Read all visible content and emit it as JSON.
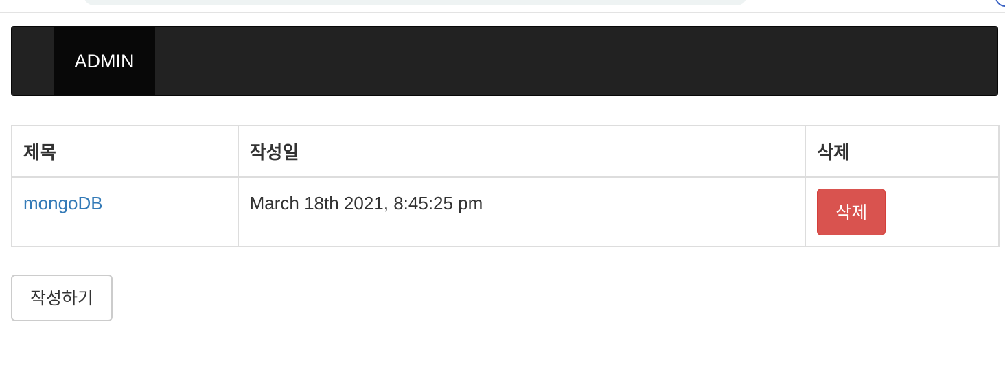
{
  "navbar": {
    "brand": "ADMIN"
  },
  "table": {
    "headers": {
      "title": "제목",
      "date": "작성일",
      "delete": "삭제"
    },
    "rows": [
      {
        "title": "mongoDB",
        "date": "March 18th 2021, 8:45:25 pm",
        "delete_label": "삭제"
      }
    ]
  },
  "actions": {
    "write_label": "작성하기"
  },
  "colors": {
    "navbar_bg": "#222222",
    "brand_bg": "#080808",
    "link": "#337ab7",
    "danger": "#d9534f"
  }
}
